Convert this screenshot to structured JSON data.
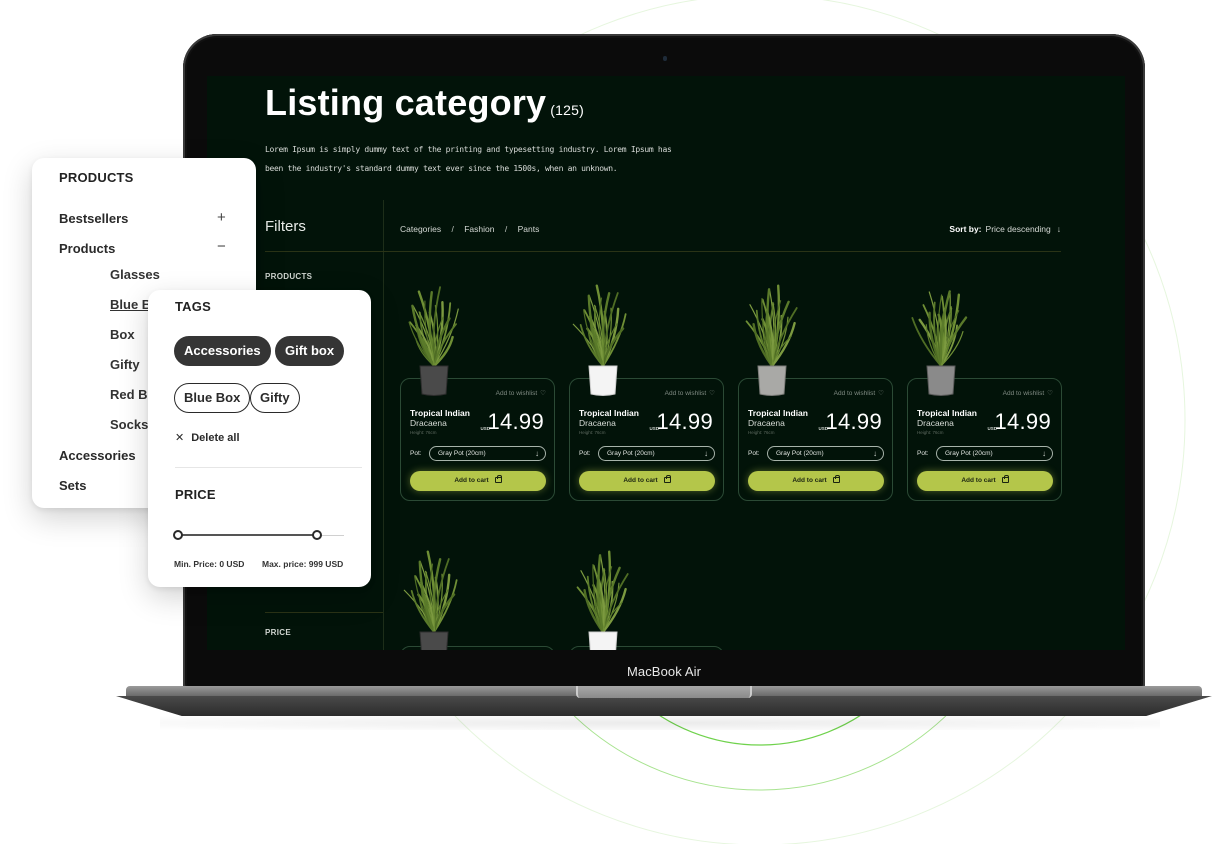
{
  "device": {
    "label": "MacBook Air"
  },
  "colors": {
    "screen_bg": "#021309",
    "accent": "#b4c64a",
    "card_border": "#2b4a35",
    "arc": "#7cd65a"
  },
  "page": {
    "title": "Listing category",
    "count": "(125)",
    "description": "Lorem Ipsum is simply dummy text of the printing and typesetting industry. Lorem Ipsum has been the industry's standard dummy text ever since the 1500s, when an unknown."
  },
  "filters": {
    "title": "Filters",
    "products_label": "PRODUCTS",
    "price_label": "PRICE",
    "delete_all_faded": "Delete all"
  },
  "breadcrumb": {
    "items": [
      "Categories",
      "Fashion",
      "Pants"
    ],
    "separator": "/"
  },
  "sort": {
    "label": "Sort by:",
    "value": "Price descending",
    "icon": "arrow-down-icon"
  },
  "products": [
    {
      "name": "Tropical Indian",
      "subname": "Dracaena",
      "height": "Height: 76cm",
      "currency": "USD",
      "price": "14.99",
      "wishlist": "Add to wishlist",
      "pot_label": "Pot:",
      "pot_value": "Gray Pot (20cm)",
      "cart": "Add to cart",
      "pot_color": "dark"
    },
    {
      "name": "Tropical Indian",
      "subname": "Dracaena",
      "height": "Height: 76cm",
      "currency": "USD",
      "price": "14.99",
      "wishlist": "Add to wishlist",
      "pot_label": "Pot:",
      "pot_value": "Gray Pot (20cm)",
      "cart": "Add to cart",
      "pot_color": "white"
    },
    {
      "name": "Tropical Indian",
      "subname": "Dracaena",
      "height": "Height: 76cm",
      "currency": "USD",
      "price": "14.99",
      "wishlist": "Add to wishlist",
      "pot_label": "Pot:",
      "pot_value": "Gray Pot (20cm)",
      "cart": "Add to cart",
      "pot_color": "stone"
    },
    {
      "name": "Tropical Indian",
      "subname": "Dracaena",
      "height": "Height: 76cm",
      "currency": "USD",
      "price": "14.99",
      "wishlist": "Add to wishlist",
      "pot_label": "Pot:",
      "pot_value": "Gray Pot (20cm)",
      "cart": "Add to cart",
      "pot_color": "gray"
    }
  ],
  "second_row_pots": [
    "dark",
    "white"
  ],
  "products_panel": {
    "title": "PRODUCTS",
    "items": [
      {
        "label": "Bestsellers",
        "toggle": "+"
      },
      {
        "label": "Products",
        "toggle": "−"
      },
      {
        "label": "Accessories"
      },
      {
        "label": "Sets"
      }
    ],
    "subitems": [
      "Glasses",
      "Blue Box",
      "Box",
      "Gifty",
      "Red Box",
      "Socks"
    ],
    "active_subitem": "Blue Box"
  },
  "tags_panel": {
    "title": "TAGS",
    "selected_tags": [
      "Accessories",
      "Gift box"
    ],
    "tags": [
      "Blue Box",
      "Gifty"
    ],
    "delete_all": "Delete all",
    "price_title": "PRICE",
    "min_price": "Min. Price: 0 USD",
    "max_price": "Max. price: 999 USD",
    "range_min_fraction": 0,
    "range_max_fraction": 0.84
  }
}
